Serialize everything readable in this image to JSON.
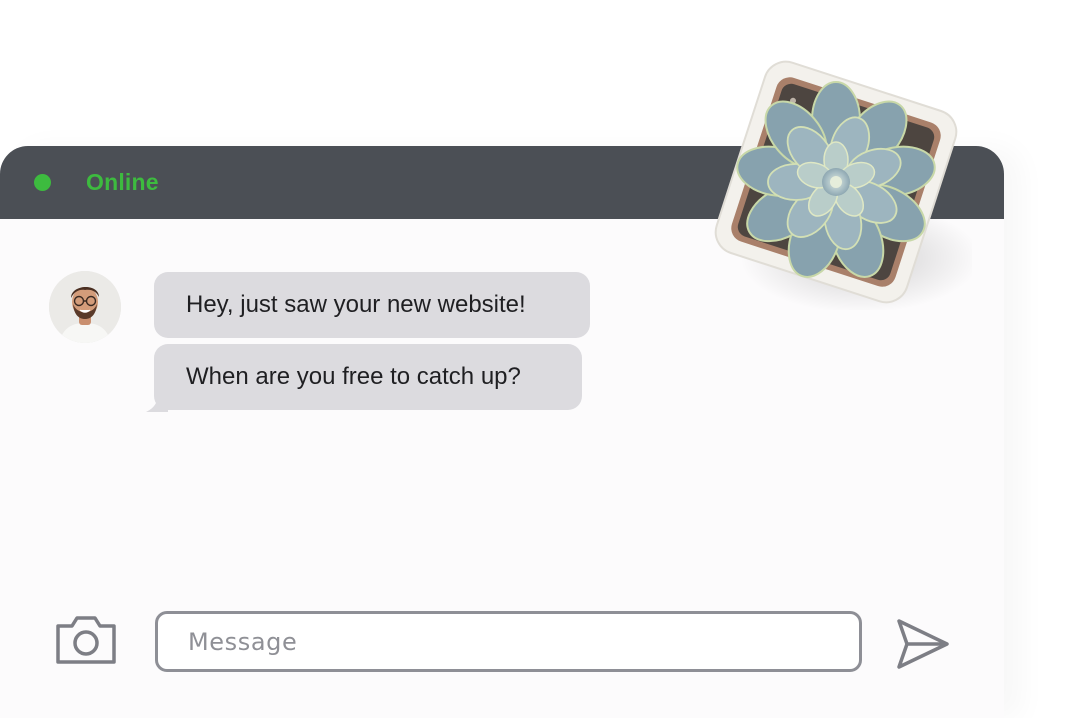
{
  "header": {
    "status_label": "Online",
    "status_color": "#3dbb3f",
    "background_color": "#4b4f55"
  },
  "contact": {
    "avatar_icon": "person-avatar"
  },
  "messages": [
    {
      "text": "Hey, just saw your new website!"
    },
    {
      "text": "When are you free to catch up?"
    }
  ],
  "composer": {
    "placeholder": "Message",
    "camera_icon": "camera-icon",
    "send_icon": "send-icon"
  },
  "decoration": {
    "image": "succulent-plant-pot"
  }
}
